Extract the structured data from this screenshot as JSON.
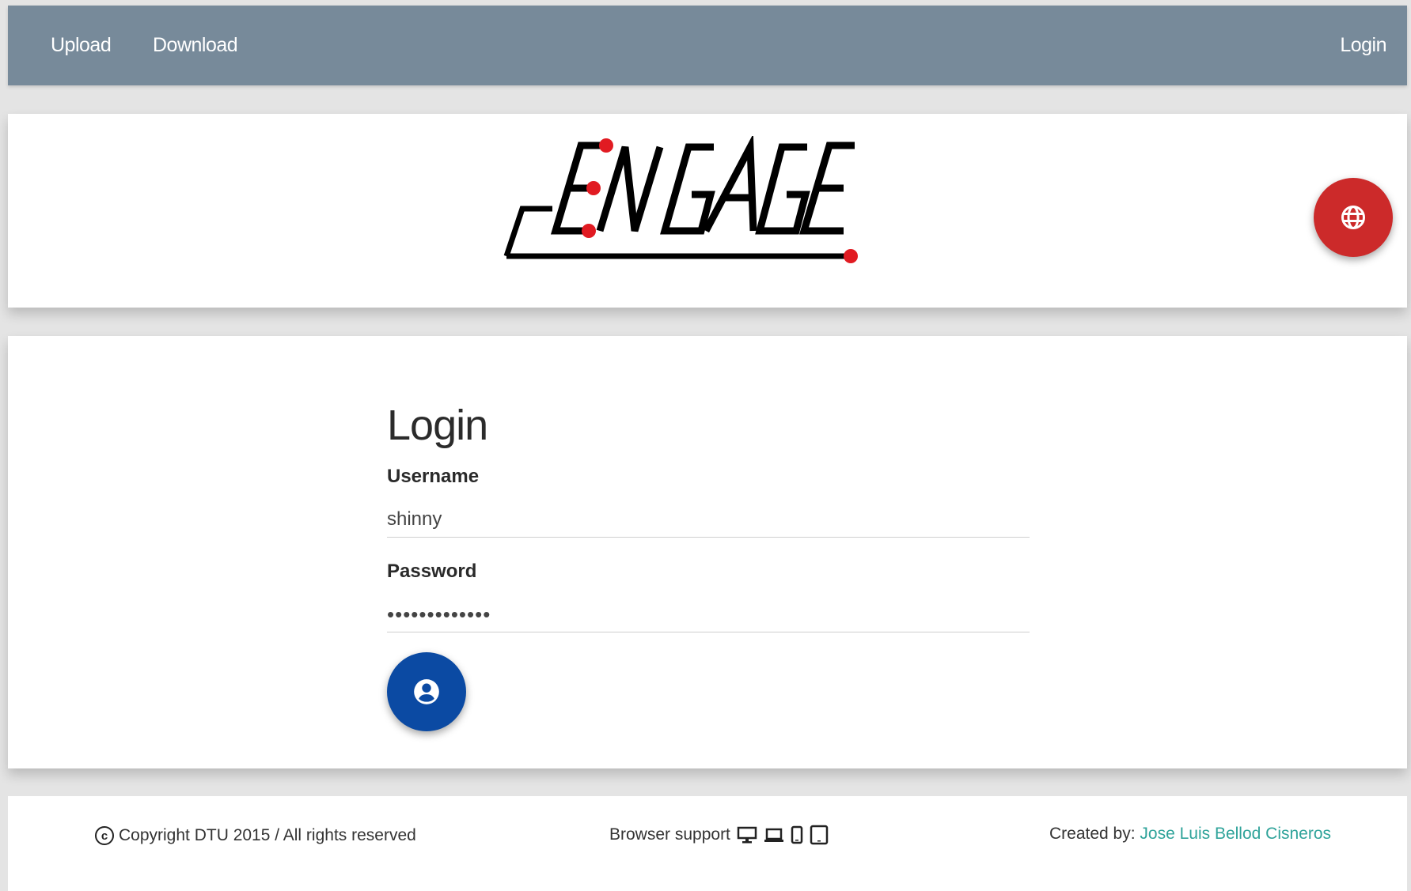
{
  "nav": {
    "upload": "Upload",
    "download": "Download",
    "login": "Login"
  },
  "header": {
    "logo_text": "ENGAGE",
    "language_button_icon": "globe-icon"
  },
  "login_form": {
    "title": "Login",
    "username_label": "Username",
    "username_value": "shinny",
    "password_label": "Password",
    "password_value": "•••••••••••••",
    "submit_icon": "account-circle-icon"
  },
  "footer": {
    "copyright": "Copyright DTU 2015 / All rights reserved",
    "browser_support": "Browser support",
    "device_icons": [
      "desktop-icon",
      "laptop-icon",
      "phone-icon",
      "tablet-icon"
    ],
    "created_by": "Created by:",
    "author": "Jose Luis Bellod Cisneros"
  },
  "colors": {
    "navbar": "#778a9a",
    "language_button": "#cc2a2a",
    "login_button": "#0b4aa3",
    "author_link": "#2fa39a",
    "logo_dots": "#e11b22"
  }
}
